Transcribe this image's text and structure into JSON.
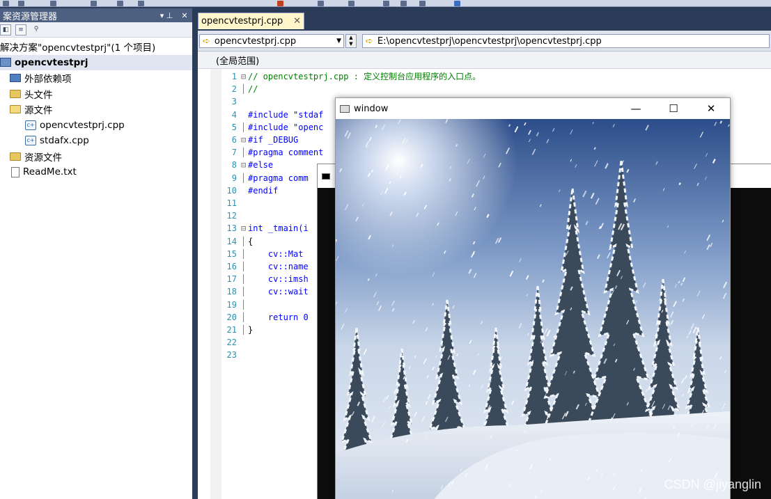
{
  "solution_explorer": {
    "title": "案资源管理器",
    "pin_glyph": "▾ ⊥",
    "close_glyph": "✕",
    "solution_label": "解决方案\"opencvtestprj\"(1 个项目)",
    "project_label": "opencvtestprj",
    "items": [
      {
        "label": "外部依赖项",
        "icon": "references-icon"
      },
      {
        "label": "头文件",
        "icon": "folder-icon"
      },
      {
        "label": "源文件",
        "icon": "folder-open-icon"
      },
      {
        "label": "opencvtestprj.cpp",
        "icon": "cpp-file-icon"
      },
      {
        "label": "stdafx.cpp",
        "icon": "cpp-file-icon"
      },
      {
        "label": "资源文件",
        "icon": "folder-icon"
      },
      {
        "label": "ReadMe.txt",
        "icon": "text-file-icon"
      }
    ]
  },
  "editor": {
    "tab_label": "opencvtestprj.cpp",
    "tab_close": "✕",
    "file_combo": "opencvtestprj.cpp",
    "path_combo": "E:\\opencvtestprj\\opencvtestprj\\opencvtestprj.cpp",
    "scope": "(全局范围)",
    "lines": [
      {
        "n": "1",
        "fold": "⊟",
        "text": "// opencvtestprj.cpp : 定义控制台应用程序的入口点。",
        "cls": "cm"
      },
      {
        "n": "2",
        "fold": "│",
        "text": "//",
        "cls": "cm"
      },
      {
        "n": "3",
        "fold": "",
        "text": "",
        "cls": "tx"
      },
      {
        "n": "4",
        "fold": "",
        "text": "#include \"stdaf",
        "cls": "pp"
      },
      {
        "n": "5",
        "fold": "│",
        "text": "#include \"openc",
        "cls": "pp"
      },
      {
        "n": "6",
        "fold": "⊟",
        "text": "#if _DEBUG",
        "cls": "pp"
      },
      {
        "n": "7",
        "fold": "│",
        "text": "#pragma comment",
        "cls": "pp"
      },
      {
        "n": "8",
        "fold": "⊟",
        "text": "#else",
        "cls": "pp"
      },
      {
        "n": "9",
        "fold": "│",
        "text": "#pragma comm",
        "cls": "pp"
      },
      {
        "n": "10",
        "fold": "",
        "text": "#endif",
        "cls": "pp"
      },
      {
        "n": "11",
        "fold": "",
        "text": "",
        "cls": "tx"
      },
      {
        "n": "12",
        "fold": "",
        "text": "",
        "cls": "tx"
      },
      {
        "n": "13",
        "fold": "⊟",
        "text": "int _tmain(i",
        "cls": "kw"
      },
      {
        "n": "14",
        "fold": "│",
        "text": "{",
        "cls": "tx"
      },
      {
        "n": "15",
        "fold": "│",
        "text": "    cv::Mat",
        "cls": "kw"
      },
      {
        "n": "16",
        "fold": "│",
        "text": "    cv::name",
        "cls": "kw"
      },
      {
        "n": "17",
        "fold": "│",
        "text": "    cv::imsh",
        "cls": "kw"
      },
      {
        "n": "18",
        "fold": "│",
        "text": "    cv::wait",
        "cls": "kw"
      },
      {
        "n": "19",
        "fold": "│",
        "text": "",
        "cls": "tx"
      },
      {
        "n": "20",
        "fold": "│",
        "text": "    return 0",
        "cls": "kw"
      },
      {
        "n": "21",
        "fold": "│",
        "text": "}",
        "cls": "tx"
      },
      {
        "n": "22",
        "fold": "",
        "text": "",
        "cls": "tx"
      },
      {
        "n": "23",
        "fold": "",
        "text": "",
        "cls": "tx"
      }
    ]
  },
  "image_window": {
    "title": "window",
    "minimize": "—",
    "maximize": "☐",
    "close": "✕"
  },
  "console_window": {
    "title": ""
  },
  "watermark": "CSDN @jiyanglin"
}
